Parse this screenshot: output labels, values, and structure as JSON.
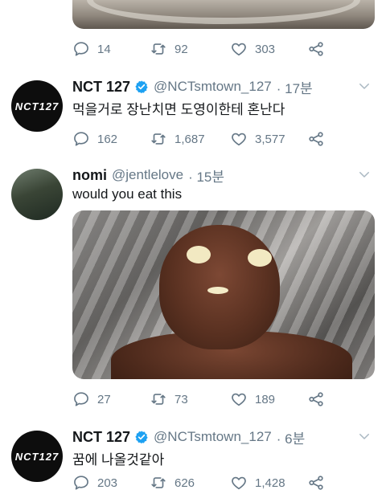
{
  "tweets": [
    {
      "id": "t0",
      "stats": {
        "replies": "14",
        "retweets": "92",
        "likes": "303"
      }
    },
    {
      "id": "t1",
      "author": {
        "name": "NCT 127",
        "handle": "@NCTsmtown_127",
        "time": "· 17분",
        "verified": true,
        "avatar_text": "NCT127"
      },
      "text": "먹을거로 장난치면 도영이한테 혼난다",
      "stats": {
        "replies": "162",
        "retweets": "1,687",
        "likes": "3,577"
      }
    },
    {
      "id": "t2",
      "author": {
        "name": "nomi",
        "handle": "@jentlelove",
        "time": "· 15분",
        "verified": false
      },
      "text": "would you eat this",
      "stats": {
        "replies": "27",
        "retweets": "73",
        "likes": "189"
      }
    },
    {
      "id": "t3",
      "author": {
        "name": "NCT 127",
        "handle": "@NCTsmtown_127",
        "time": "· 6분",
        "verified": true,
        "avatar_text": "NCT127"
      },
      "text": "꿈에 나올것같아",
      "stats": {
        "replies": "203",
        "retweets": "626",
        "likes": "1,428"
      }
    }
  ],
  "colors": {
    "muted": "#657786",
    "verified": "#1da1f2",
    "text": "#14171a"
  }
}
